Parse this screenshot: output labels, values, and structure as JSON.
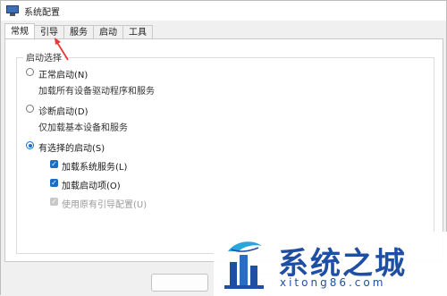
{
  "window": {
    "title": "系统配置",
    "icon": "system-config-icon"
  },
  "tabs": [
    {
      "label": "常规",
      "active": true
    },
    {
      "label": "引导",
      "active": false
    },
    {
      "label": "服务",
      "active": false
    },
    {
      "label": "启动",
      "active": false
    },
    {
      "label": "工具",
      "active": false
    }
  ],
  "startup": {
    "group_label": "启动选择",
    "normal": {
      "label": "正常启动(N)",
      "desc": "加载所有设备驱动程序和服务",
      "checked": false
    },
    "diagnostic": {
      "label": "诊断启动(D)",
      "desc": "仅加载基本设备和服务",
      "checked": false
    },
    "selective": {
      "label": "有选择的启动(S)",
      "checked": true,
      "options": [
        {
          "label": "加载系统服务(L)",
          "checked": true,
          "enabled": true
        },
        {
          "label": "加载启动项(O)",
          "checked": true,
          "enabled": true
        },
        {
          "label": "使用原有引导配置(U)",
          "checked": true,
          "enabled": false
        }
      ]
    }
  },
  "annotation": {
    "arrow_color": "#e53935"
  },
  "watermark": {
    "title": "系统之城",
    "url": "xitong86.com",
    "color": "#1f4fa3"
  }
}
